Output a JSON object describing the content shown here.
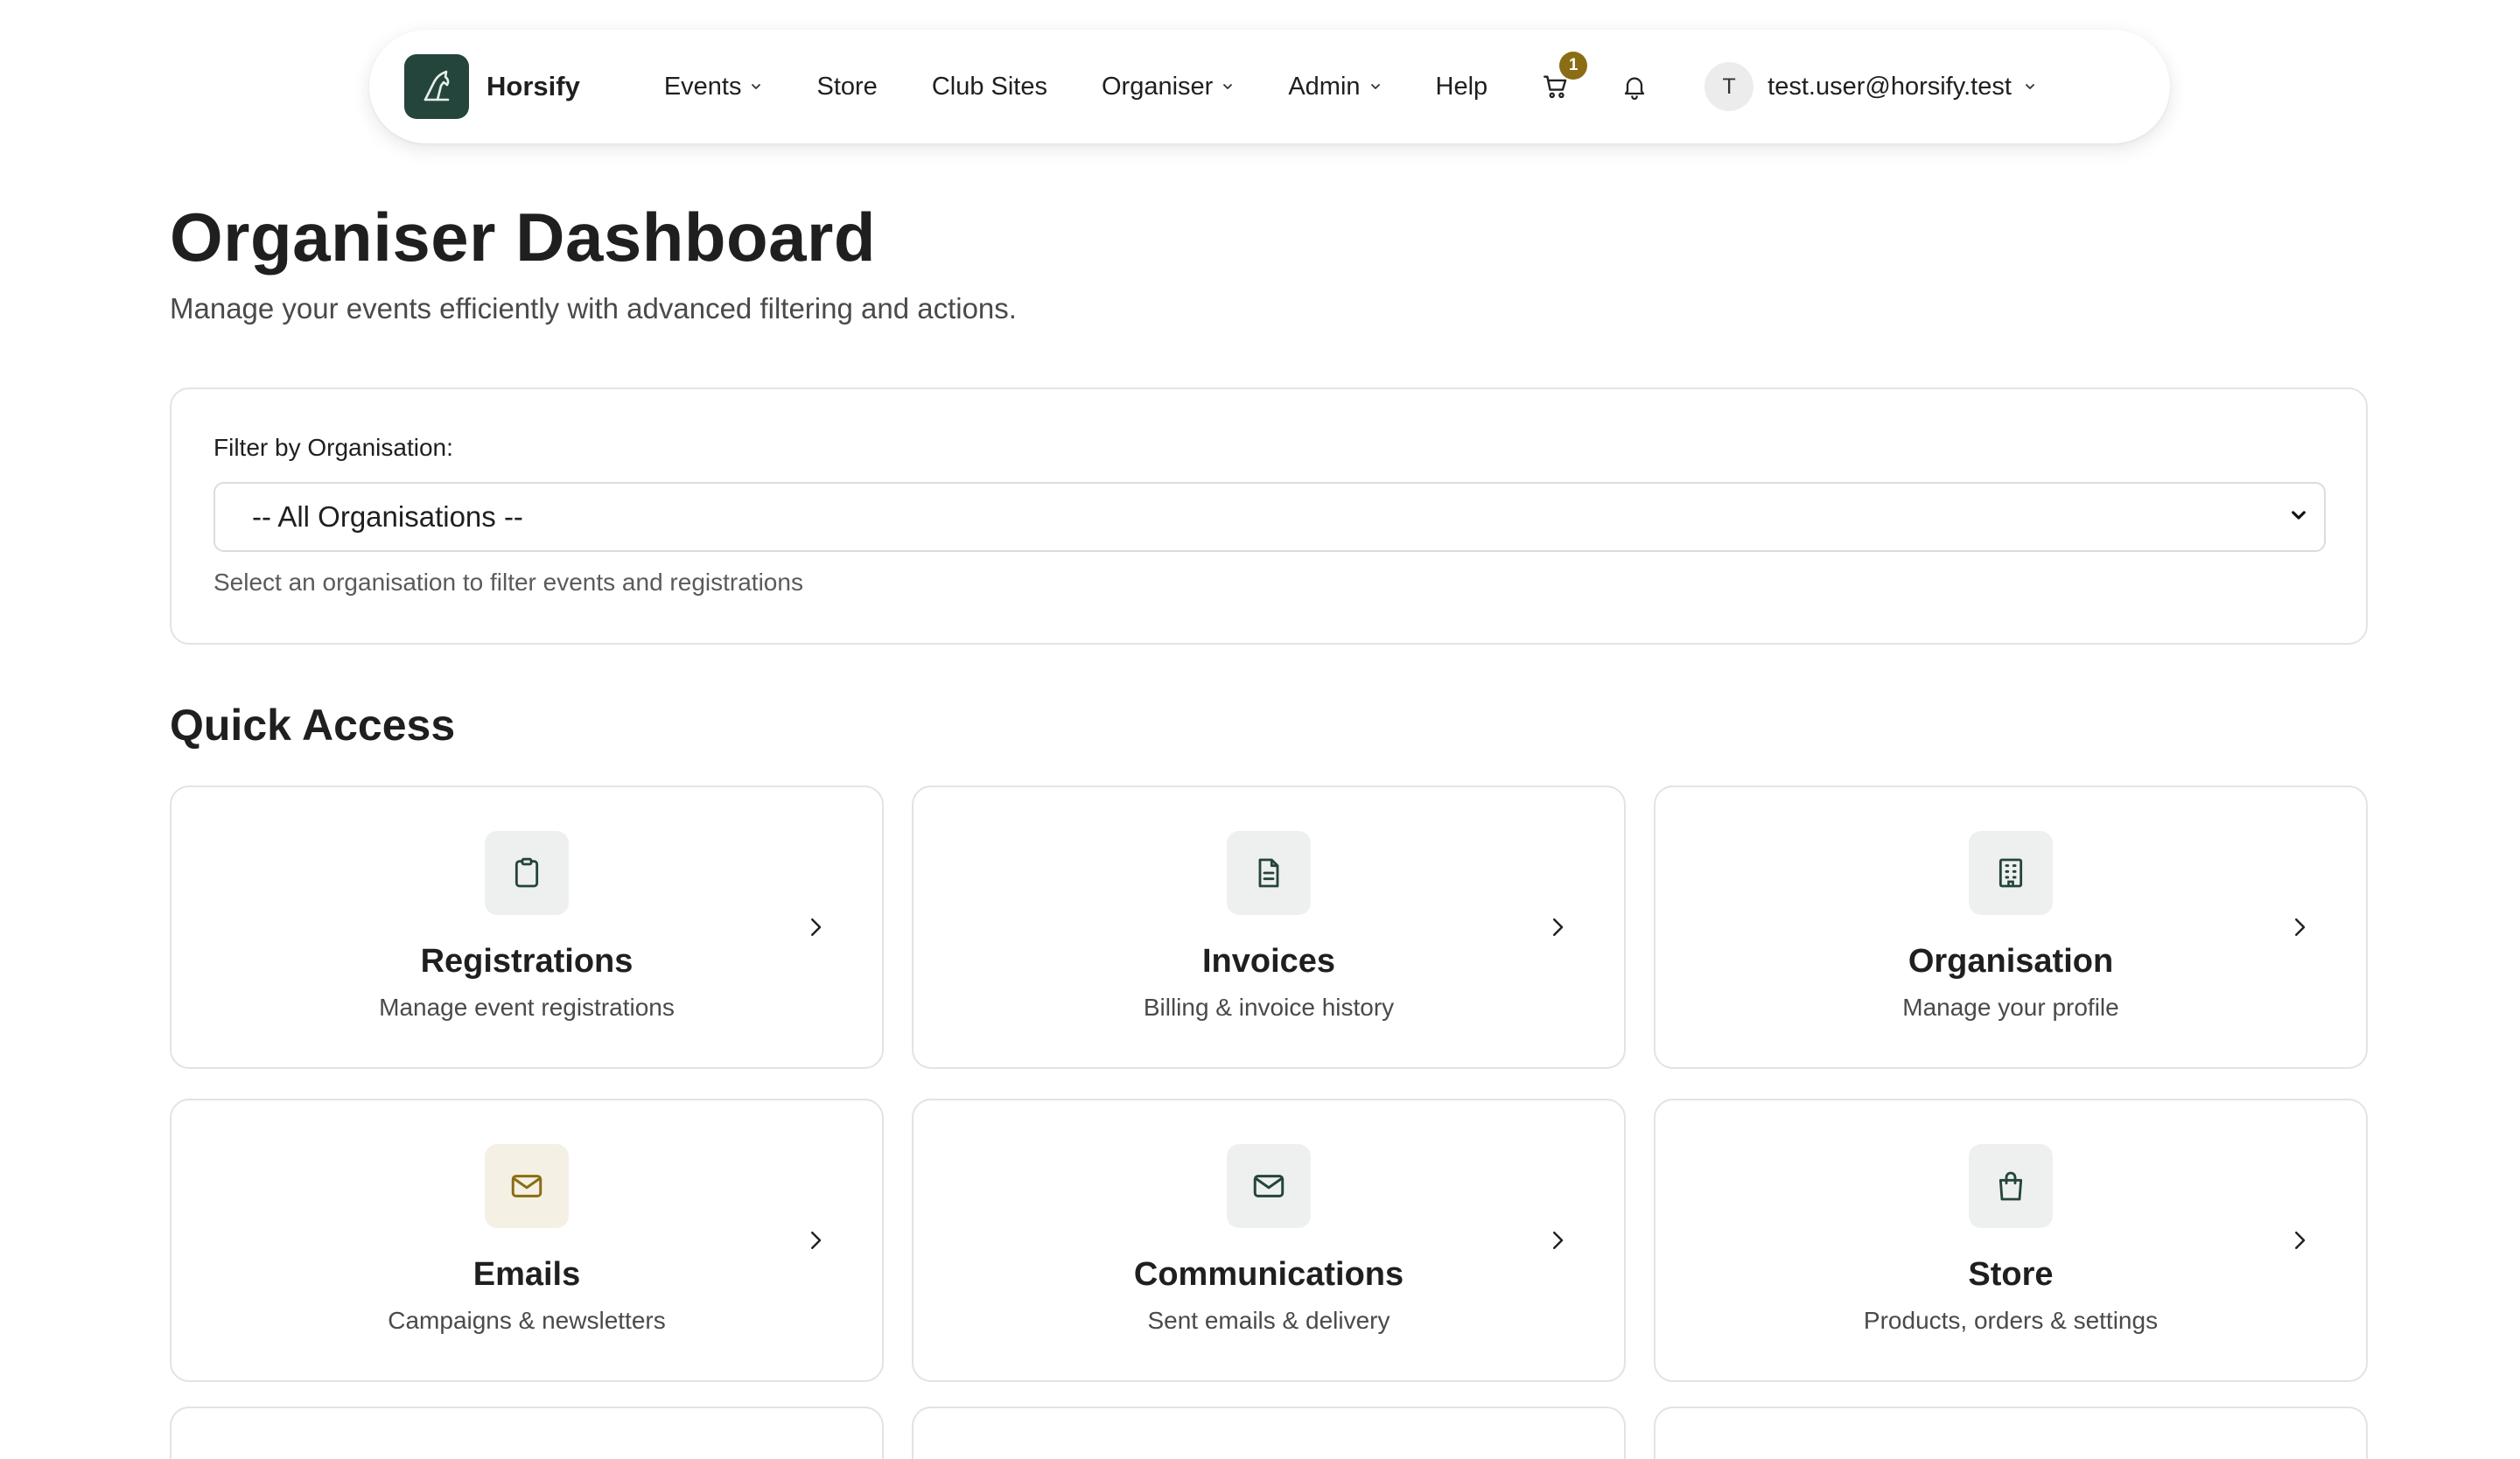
{
  "nav": {
    "brand": "Horsify",
    "items": [
      {
        "label": "Events",
        "has_dropdown": true
      },
      {
        "label": "Store",
        "has_dropdown": false
      },
      {
        "label": "Club Sites",
        "has_dropdown": false
      },
      {
        "label": "Organiser",
        "has_dropdown": true
      },
      {
        "label": "Admin",
        "has_dropdown": true
      },
      {
        "label": "Help",
        "has_dropdown": false
      }
    ],
    "cart_count": "1",
    "user": {
      "initial": "T",
      "email": "test.user@horsify.test"
    }
  },
  "header": {
    "title": "Organiser Dashboard",
    "subtitle": "Manage your events efficiently with advanced filtering and actions."
  },
  "filter": {
    "label": "Filter by Organisation:",
    "selected": "-- All Organisations --",
    "help": "Select an organisation to filter events and registrations"
  },
  "quick_access": {
    "title": "Quick Access",
    "cards": [
      {
        "title": "Registrations",
        "desc": "Manage event registrations",
        "icon": "clipboard-icon"
      },
      {
        "title": "Invoices",
        "desc": "Billing & invoice history",
        "icon": "document-icon"
      },
      {
        "title": "Organisation",
        "desc": "Manage your profile",
        "icon": "building-icon"
      },
      {
        "title": "Emails",
        "desc": "Campaigns & newsletters",
        "icon": "mail-icon"
      },
      {
        "title": "Communications",
        "desc": "Sent emails & delivery",
        "icon": "mail-icon"
      },
      {
        "title": "Store",
        "desc": "Products, orders & settings",
        "icon": "shopping-bag-icon"
      }
    ]
  },
  "colors": {
    "brand_green": "#24453b",
    "badge_gold": "#8a6d14",
    "emails_icon_accent": "#8a6d14"
  }
}
